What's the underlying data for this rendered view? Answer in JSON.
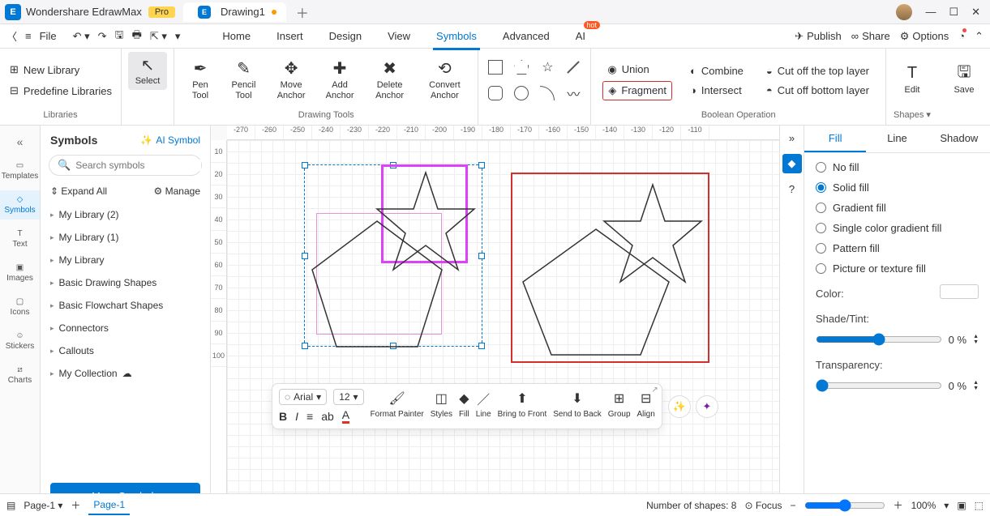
{
  "app": {
    "name": "Wondershare EdrawMax",
    "badge": "Pro",
    "tab_name": "Drawing1"
  },
  "menu": {
    "file": "File",
    "tabs": [
      "Home",
      "Insert",
      "Design",
      "View",
      "Symbols",
      "Advanced",
      "AI"
    ],
    "active_tab": "Symbols",
    "publish": "Publish",
    "share": "Share",
    "options": "Options"
  },
  "ribbon": {
    "libraries": {
      "new": "New Library",
      "predef": "Predefine Libraries",
      "label": "Libraries"
    },
    "select": "Select",
    "drawing_tools": {
      "label": "Drawing Tools",
      "items": [
        "Pen Tool",
        "Pencil Tool",
        "Move Anchor",
        "Add Anchor",
        "Delete Anchor",
        "Convert Anchor"
      ]
    },
    "boolean": {
      "label": "Boolean Operation",
      "items": [
        "Union",
        "Fragment",
        "Combine",
        "Intersect",
        "Cut off the top layer",
        "Cut off bottom layer"
      ]
    },
    "edit": "Edit",
    "shapes": "Shapes",
    "save": "Save"
  },
  "leftrail": [
    "Templates",
    "Symbols",
    "Text",
    "Images",
    "Icons",
    "Stickers",
    "Charts"
  ],
  "symbols_panel": {
    "title": "Symbols",
    "ai": "AI Symbol",
    "search_placeholder": "Search symbols",
    "expand": "Expand All",
    "manage": "Manage",
    "items": [
      "My Library (2)",
      "My Library (1)",
      "My Library",
      "Basic Drawing Shapes",
      "Basic Flowchart Shapes",
      "Connectors",
      "Callouts",
      "My Collection"
    ],
    "more": "More Symbols"
  },
  "ruler_h": [
    "-270",
    "-260",
    "-250",
    "-240",
    "-230",
    "-220",
    "-210",
    "-200",
    "-190",
    "-180",
    "-170",
    "-160",
    "-150",
    "-140",
    "-130",
    "-120",
    "-110"
  ],
  "ruler_v": [
    "10",
    "20",
    "30",
    "40",
    "50",
    "60",
    "70",
    "80",
    "90",
    "100"
  ],
  "float_toolbar": {
    "font": "Arial",
    "size": "12",
    "cols": [
      "Format Painter",
      "Styles",
      "Fill",
      "Line",
      "Bring to Front",
      "Send to Back",
      "Group",
      "Align"
    ]
  },
  "right_panel": {
    "tabs": [
      "Fill",
      "Line",
      "Shadow"
    ],
    "fill_options": [
      "No fill",
      "Solid fill",
      "Gradient fill",
      "Single color gradient fill",
      "Pattern fill",
      "Picture or texture fill"
    ],
    "selected_fill": 1,
    "color_label": "Color:",
    "shade_label": "Shade/Tint:",
    "shade_val": "0 %",
    "trans_label": "Transparency:",
    "trans_val": "0 %"
  },
  "status": {
    "page_sel": "Page-1",
    "page_tab": "Page-1",
    "shapes": "Number of shapes: 8",
    "focus": "Focus",
    "zoom": "100%"
  }
}
